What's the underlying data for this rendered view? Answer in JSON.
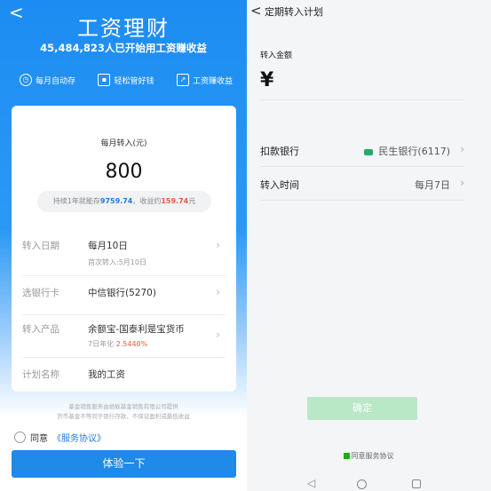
{
  "left": {
    "back_glyph": "<",
    "title": "工资理财",
    "subtitle_count": "45,484,823",
    "subtitle_text": "人已开始用工资赚收益",
    "features": [
      {
        "icon": "clock-icon",
        "label": "每月自动存"
      },
      {
        "icon": "wallet-icon",
        "label": "轻松管好钱"
      },
      {
        "icon": "trend-chart-icon",
        "label": "工资赚收益"
      }
    ],
    "card": {
      "label": "每月转入(元)",
      "amount": "800",
      "pill_prefix": "持续1年就能存",
      "pill_saved": "9759.74",
      "pill_middle": "，收益约",
      "pill_earnings": "159.74",
      "pill_suffix": "元",
      "rows": [
        {
          "key": "转入日期",
          "value": "每月10日",
          "sub": "首次转入:5月10日"
        },
        {
          "key": "选银行卡",
          "value": "中信银行(5270)"
        },
        {
          "key": "转入产品",
          "value": "余额宝-国泰利是宝货币",
          "sub_prefix": "7日年化 ",
          "rate": "2.5440%"
        },
        {
          "key": "计划名称",
          "value": "我的工资"
        }
      ]
    },
    "disclaimer_1": "基金销售服务由蚂蚁基金销售有限公司提供",
    "disclaimer_2": "货币基金不等同于银行存款，不保证盈利或最低收益",
    "agree_prefix": "同意",
    "agree_link": "《服务协议》",
    "cta": "体验一下"
  },
  "right": {
    "back_glyph": "<",
    "title": "定期转入计划",
    "amount_label": "转入金额",
    "currency_symbol": "¥",
    "rows": [
      {
        "key": "扣款银行",
        "value": "民生银行(6117)",
        "icon": "bank-logo-icon"
      },
      {
        "key": "转入时间",
        "value": "每月7日"
      }
    ],
    "confirm": "确定",
    "agree_text": "同意服务协议"
  },
  "colors": {
    "primary_blue": "#1f8ae8",
    "accent_red": "#e9573f",
    "confirm_disabled_green": "#b9e8c6",
    "check_green": "#1aad19"
  }
}
